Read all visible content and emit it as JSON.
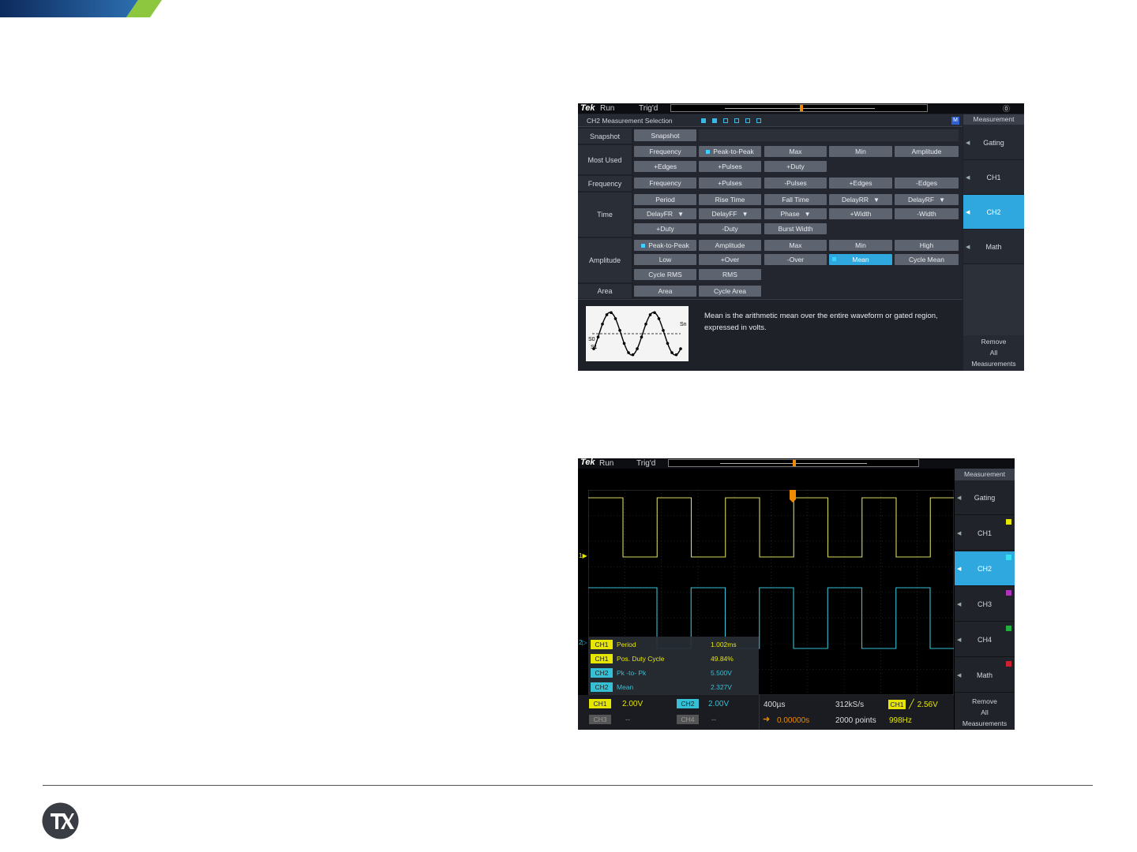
{
  "colors": {
    "accent": "#2fa8df",
    "ch1": "#e6e600",
    "ch2": "#2fc3d8",
    "ch3": "#b030c0",
    "ch4": "#20b040",
    "math": "#d02030",
    "banner_blue": "#1f3b73",
    "banner_green": "#8dc63f"
  },
  "scope1": {
    "brand": "Tek",
    "run": "Run",
    "trig": "Trig'd",
    "title": "CH2 Measurement Selection",
    "badge": "M",
    "rows": {
      "snapshot": {
        "label": "Snapshot",
        "buttons": [
          "Snapshot"
        ]
      },
      "most_used": {
        "label": "Most Used",
        "buttons": [
          "Frequency",
          "Peak-to-Peak",
          "Max",
          "Min",
          "Amplitude",
          "+Edges",
          "+Pulses",
          "+Duty"
        ]
      },
      "frequency": {
        "label": "Frequency",
        "buttons": [
          "Frequency",
          "+Pulses",
          "-Pulses",
          "+Edges",
          "-Edges"
        ]
      },
      "time": {
        "label": "Time",
        "buttons": [
          "Period",
          "Rise Time",
          "Fall Time",
          "DelayRR",
          "DelayRF",
          "DelayFR",
          "DelayFF",
          "Phase",
          "+Width",
          "-Width",
          "+Duty",
          "-Duty",
          "Burst Width"
        ]
      },
      "amplitude": {
        "label": "Amplitude",
        "buttons": [
          "Peak-to-Peak",
          "Amplitude",
          "Max",
          "Min",
          "High",
          "Low",
          "+Over",
          "-Over",
          "Mean",
          "Cycle Mean",
          "Cycle RMS",
          "RMS"
        ]
      },
      "area": {
        "label": "Area",
        "buttons": [
          "Area",
          "Cycle Area"
        ]
      }
    },
    "description": "Mean is the arithmetic mean over the entire waveform or gated region, expressed in volts.",
    "diagram_labels": {
      "s0": "S0",
      "s1": "S1",
      "sn": "Sn"
    },
    "side": {
      "header": "Measurement",
      "items": [
        "Gating",
        "CH1",
        "CH2",
        "Math"
      ],
      "remove": [
        "Remove",
        "All",
        "Measurements"
      ]
    }
  },
  "scope2": {
    "brand": "Tek",
    "run": "Run",
    "trig": "Trig'd",
    "ch1_marker": "1",
    "ch2_marker": "2",
    "measurements": [
      {
        "ch": "CH1",
        "name": "Period",
        "value": "1.002ms"
      },
      {
        "ch": "CH1",
        "name": "Pos. Duty Cycle",
        "value": "49.84%"
      },
      {
        "ch": "CH2",
        "name": "Pk -to- Pk",
        "value": "5.500V"
      },
      {
        "ch": "CH2",
        "name": "Mean",
        "value": "2.327V"
      }
    ],
    "bottom": {
      "ch1": "CH1",
      "ch1_scale": "2.00V",
      "ch2": "CH2",
      "ch2_scale": "2.00V",
      "ch3": "CH3",
      "ch3_scale": "--",
      "ch4": "CH4",
      "ch4_scale": "--",
      "timebase": "400µs",
      "sample_rate": "312kS/s",
      "trig_ch": "CH1",
      "trig_level": "2.56V",
      "position": "0.00000s",
      "record": "2000 points",
      "freq": "998Hz"
    },
    "side": {
      "header": "Measurement",
      "items": [
        "Gating",
        "CH1",
        "CH2",
        "CH3",
        "CH4",
        "Math"
      ],
      "remove": [
        "Remove",
        "All",
        "Measurements"
      ]
    }
  }
}
